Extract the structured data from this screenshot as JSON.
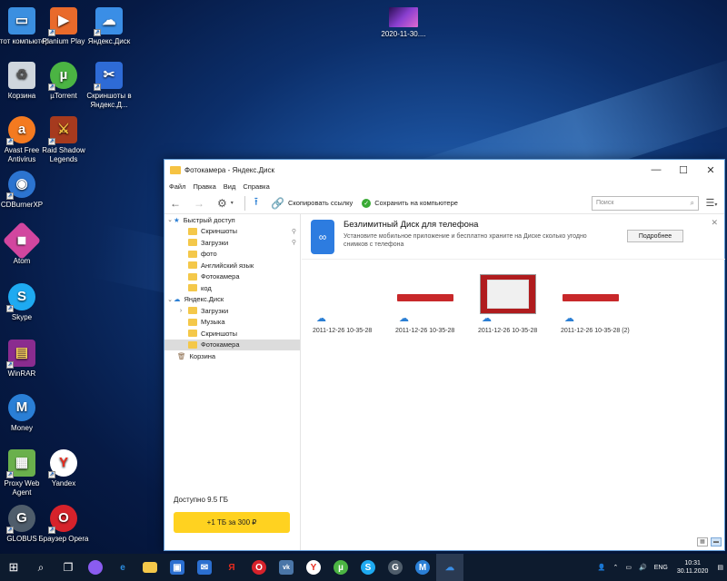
{
  "desktop": {
    "icons": [
      {
        "label": "Этот компьютер",
        "icon": "computer-icon",
        "color": "#3b8fe0"
      },
      {
        "label": "Planium Play",
        "icon": "planium-icon",
        "color": "#e96a2b"
      },
      {
        "label": "Яндекс.Диск",
        "icon": "yandex-disk-icon",
        "color": "#3a8ee6"
      },
      {
        "label": "Корзина",
        "icon": "recycle-bin-icon",
        "color": "#cfd6dd"
      },
      {
        "label": "µTorrent",
        "icon": "utorrent-icon",
        "color": "#4bb443"
      },
      {
        "label": "Скриншоты в Яндекс.Д...",
        "icon": "screenshot-icon",
        "color": "#2e6bd6"
      },
      {
        "label": "Avast Free Antivirus",
        "icon": "avast-icon",
        "color": "#f47a20"
      },
      {
        "label": "Raid Shadow Legends",
        "icon": "raid-icon",
        "color": "#a63a1e"
      },
      {
        "label": "CDBurnerXP",
        "icon": "cdburner-icon",
        "color": "#2c74d0"
      },
      {
        "label": "Atom",
        "icon": "atom-icon",
        "color": "#d2469f"
      },
      {
        "label": "Skype",
        "icon": "skype-icon",
        "color": "#1eaaf1"
      },
      {
        "label": "WinRAR",
        "icon": "winrar-icon",
        "color": "#8a2c8f"
      },
      {
        "label": "Money",
        "icon": "money-icon",
        "color": "#2a7fd6"
      },
      {
        "label": "Proxy Web Agent",
        "icon": "proxy-icon",
        "color": "#6ab04c"
      },
      {
        "label": "Yandex",
        "icon": "yandex-browser-icon",
        "color": "#ffffff"
      },
      {
        "label": "GLOBUS",
        "icon": "globus-icon",
        "color": "#4f5d6b"
      },
      {
        "label": "Браузер Opera",
        "icon": "opera-icon",
        "color": "#d6222b"
      },
      {
        "label": "2020-11-30....",
        "icon": "video-file-icon",
        "color": "#8a3fd0"
      }
    ]
  },
  "window": {
    "title": "Фотокамера - Яндекс.Диск",
    "menu": [
      "Файл",
      "Правка",
      "Вид",
      "Справка"
    ],
    "toolbar": {
      "copy_link": "Скопировать ссылку",
      "save_to_pc": "Сохранить на компьютере",
      "search_placeholder": "Поиск"
    },
    "sidebar": {
      "quick_access": "Быстрый доступ",
      "quick_items": [
        "Скриншоты",
        "Загрузки",
        "фото",
        "Английский язык",
        "Фотокамера",
        "код"
      ],
      "disk_root": "Яндекс.Диск",
      "disk_items": [
        "Загрузки",
        "Музыка",
        "Скриншоты",
        "Фотокамера"
      ],
      "trash": "Корзина",
      "available": "Доступно 9.5 ГБ",
      "buy_button": "+1 ТБ за 300 ₽"
    },
    "promo": {
      "title": "Безлимитный Диск для телефона",
      "description": "Установите мобильное приложение и бесплатно храните на Диске сколько угодно снимков с телефона",
      "button": "Подробнее"
    },
    "files": [
      {
        "name": "2011-12-26 10-35-28"
      },
      {
        "name": "2011-12-26 10-35-28"
      },
      {
        "name": "2011-12-26 10-35-28"
      },
      {
        "name": "2011-12-26 10-35-28 (2)"
      }
    ]
  },
  "taskbar": {
    "lang": "ENG",
    "time": "10:31",
    "date": "30.11.2020"
  }
}
